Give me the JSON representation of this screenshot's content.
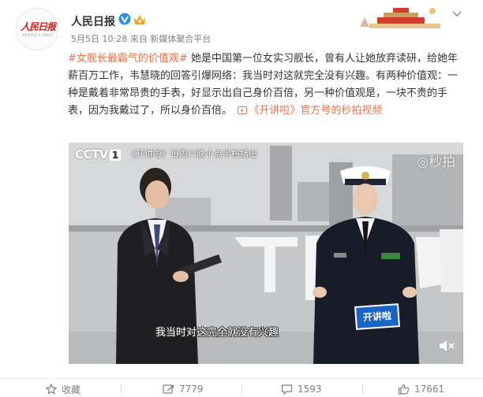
{
  "account": {
    "name": "人民日报",
    "logo_text": "人民日报",
    "logo_sub": "PEOPLE'S DAILY"
  },
  "post_meta": {
    "date": "5月5日 10:28",
    "source": "来自 新媒体聚合平台"
  },
  "post": {
    "hashtag": "#女舰长最霸气的价值观#",
    "body_1": "她是中国第一位女实习舰长，曾有人让她放弃读研，给她年薪百万工作，韦慧晓的回答引爆网络：我当时对这就完全没有兴趣。有两种价值观：一种是戴着非常昂贵的手表，好显示出自己身价百倍，另一种价值观是，一块不贵的手表，因为我戴过了，所以身价百倍。",
    "link": "《开讲啦》官方号的秒拍视频"
  },
  "video": {
    "channel": "CCTV",
    "channel_num": "1",
    "show_info": "《开讲啦》每周六晚十点半档播出",
    "watermark": "秒拍",
    "subtitle": "我当时对这完全就没有兴趣",
    "program_badge": "开讲啦"
  },
  "actions": {
    "favorite": "收藏",
    "repost": "7779",
    "comment": "1593",
    "like": "17661"
  },
  "colors": {
    "accent": "#eb7350",
    "brand_red": "#d8211b"
  }
}
